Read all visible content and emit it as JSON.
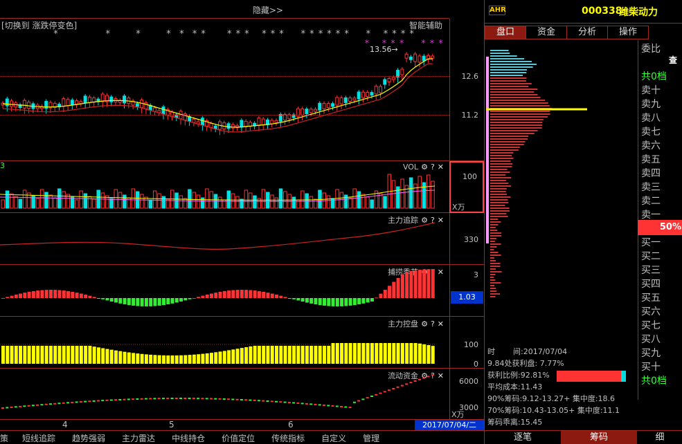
{
  "toolbar": {
    "hide_label": "隐藏>>"
  },
  "main_chart": {
    "switch_label": "[切换到 涨跌停变色]",
    "smart_label": "智能辅助",
    "price_marker": "13.56→",
    "ticks": [
      "12.6",
      "11.2"
    ]
  },
  "vol_panel": {
    "title": "VOL",
    "tick": "100",
    "unit": "X万",
    "left_mark": "3"
  },
  "zhuli_zhuizong": {
    "title": "主力追踪",
    "tick": "330"
  },
  "buzhuo": {
    "title": "捕捞季节",
    "tick": "3",
    "value": "1.03"
  },
  "zhuli_kongpan": {
    "title": "主力控盘",
    "ticks": [
      "100",
      "0"
    ]
  },
  "liudong": {
    "title": "流动资金",
    "ticks": [
      "6000",
      "3000"
    ],
    "unit": "X万"
  },
  "time_axis": {
    "labels": [
      "4",
      "5",
      "6"
    ],
    "date": "2017/07/04/二"
  },
  "bottom_tabs": [
    "策",
    "短线追踪",
    "趋势强弱",
    "主力雷达",
    "中线持仓",
    "价值定位",
    "传统指标",
    "自定义",
    "管理"
  ],
  "stock": {
    "logo": "AHR",
    "code": "000338",
    "name": "潍柴动力"
  },
  "right_tabs": [
    "盘口",
    "资金",
    "分析",
    "操作"
  ],
  "order_book": {
    "committee_label": "委比",
    "query_label": "查",
    "sell_total": "共0档",
    "sell": [
      "卖十",
      "卖九",
      "卖八",
      "卖七",
      "卖六",
      "卖五",
      "卖四",
      "卖三",
      "卖二",
      "卖一"
    ],
    "ratio": "50%",
    "buy": [
      "买一",
      "买二",
      "买三",
      "买四",
      "买五",
      "买六",
      "买七",
      "买八",
      "买九",
      "买十"
    ],
    "buy_total": "共0档"
  },
  "chip": {
    "time_label": "时",
    "time_mid": "间:2017/07/04",
    "profit_price": "9.84处获利盘: 7.77%",
    "profit_ratio": "获利比例:92.81%",
    "avg_cost": "平均成本:11.43",
    "c90": "90%筹码:9.12-13.27+ 集中度:18.6",
    "c70": "70%筹码:10.43-13.05+ 集中度:11.1",
    "deviation": "筹码乖离:15.45"
  },
  "right_bottom_tabs": [
    "逐笔",
    "筹码",
    "细"
  ],
  "colors": {
    "up": "#ff3333",
    "down": "#00e0e0",
    "border": "#a0281e",
    "ma_yellow": "#ffff00"
  }
}
